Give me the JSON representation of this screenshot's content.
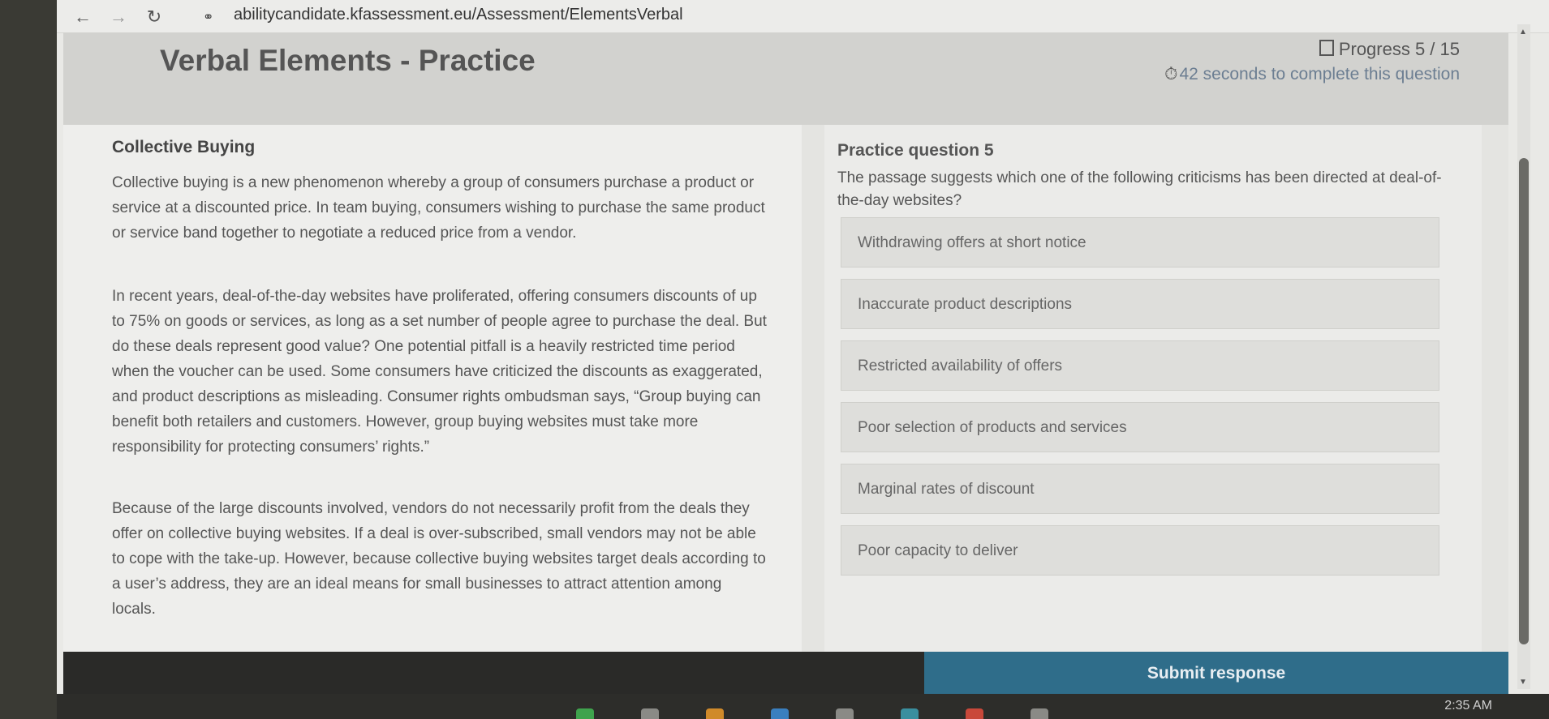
{
  "browser": {
    "url": "abilitycandidate.kfassessment.eu/Assessment/ElementsVerbal"
  },
  "header": {
    "title": "Verbal Elements - Practice",
    "progress": "Progress 5 / 15",
    "timer": "42 seconds to complete this question"
  },
  "passage": {
    "title": "Collective Buying",
    "paragraphs": [
      "Collective buying is a new phenomenon whereby a group of consumers purchase a product or service at a discounted price. In team buying, consumers wishing to purchase the same product or service band together to negotiate a reduced price from a vendor.",
      "In recent years, deal-of-the-day websites have proliferated, offering consumers discounts of up to 75% on goods or services, as long as a set number of people agree to purchase the deal. But do these deals represent good value? One potential pitfall is a heavily restricted time period when the voucher can be used. Some consumers have criticized the discounts as exaggerated, and product descriptions as misleading. Consumer rights ombudsman says, “Group buying can benefit both retailers and customers. However, group buying websites must take more responsibility for protecting consumers’ rights.”",
      "Because of the large discounts involved, vendors do not necessarily profit from the deals they offer on collective buying websites. If a deal is over-subscribed, small vendors may not be able to cope with the take-up. However, because collective buying websites target deals according to a user’s address, they are an ideal means for small businesses to attract attention among locals."
    ]
  },
  "question": {
    "heading": "Practice question 5",
    "text": "The passage suggests which one of the following criticisms has been directed at deal-of-the-day websites?",
    "options": [
      "Withdrawing offers at short notice",
      "Inaccurate product descriptions",
      "Restricted availability of offers",
      "Poor selection of products and services",
      "Marginal rates of discount",
      "Poor capacity to deliver"
    ]
  },
  "footer": {
    "submit_label": "Submit response"
  },
  "taskbar": {
    "clock": "2:35 AM"
  }
}
